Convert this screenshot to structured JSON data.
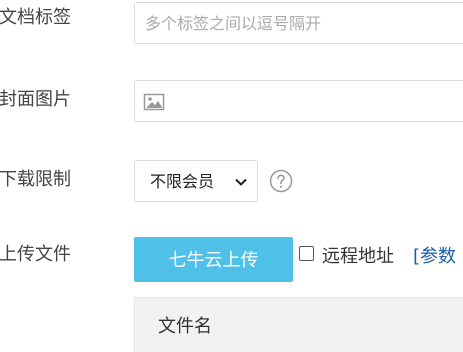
{
  "form": {
    "tags": {
      "label": "文档标签",
      "placeholder": "多个标签之间以逗号隔开"
    },
    "cover": {
      "label": "封面图片"
    },
    "download_limit": {
      "label": "下载限制",
      "selected": "不限会员"
    },
    "upload": {
      "label": "上传文件",
      "button": "七牛云上传",
      "remote_label": "远程地址",
      "param_link": "[参数"
    },
    "file_table": {
      "columns": [
        "文件名"
      ]
    }
  },
  "colors": {
    "accent": "#4fc0e8",
    "link": "#1d5fa8"
  }
}
